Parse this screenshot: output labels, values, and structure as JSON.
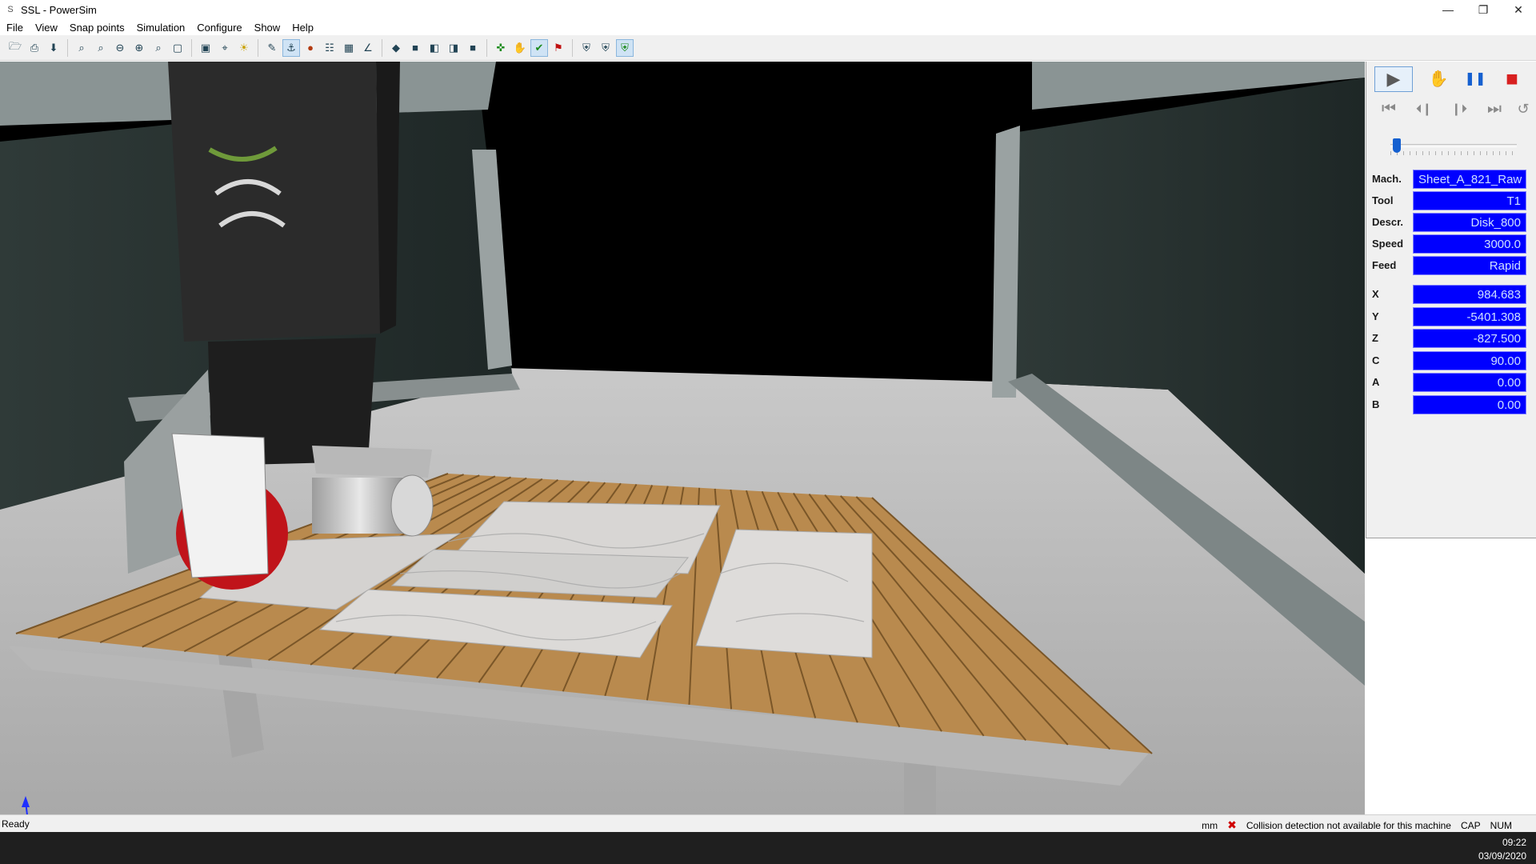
{
  "window": {
    "app_icon_glyph": "S",
    "title": "SSL - PowerSim",
    "minimize_glyph": "—",
    "restore_glyph": "❐",
    "close_glyph": "✕"
  },
  "menu": [
    "File",
    "View",
    "Snap points",
    "Simulation",
    "Configure",
    "Show",
    "Help"
  ],
  "toolbar": {
    "groups": [
      [
        "open-icon",
        "print-icon",
        "import-icon"
      ],
      [
        "zoom-icon",
        "zoom-window-icon",
        "zoom-out-icon",
        "zoom-in-icon",
        "zoom-fit-icon",
        "frame-icon"
      ],
      [
        "camera-icon",
        "select-icon",
        "light-icon"
      ],
      [
        "edit-path-icon",
        "tool-axis-icon",
        "sphere-icon",
        "table-icon",
        "grid-icon",
        "axes-icon"
      ],
      [
        "view-iso-icon",
        "view-front-icon",
        "view-left-icon",
        "view-right-icon",
        "view-top-icon"
      ],
      [
        "move-icon",
        "hand-icon",
        "check-icon",
        "flag-icon"
      ],
      [
        "shield-icon",
        "shield-outline-icon",
        "shield-green-icon"
      ]
    ]
  },
  "sim_controls": {
    "play_glyph": "▶",
    "hand_glyph": "✋",
    "pause_glyph": "❚❚",
    "stop_glyph": "■",
    "first_glyph": "⏮",
    "prev_glyph": "⏴❙",
    "next_glyph": "❙⏵",
    "last_glyph": "⏭",
    "loop_glyph": "↺",
    "slider_position": 0.05
  },
  "info": [
    {
      "label": "Mach.",
      "value": "Sheet_A_821_Raw",
      "align": "left"
    },
    {
      "label": "Tool",
      "value": "T1",
      "align": "right"
    },
    {
      "label": "Descr.",
      "value": "Disk_800",
      "align": "right"
    },
    {
      "label": "Speed",
      "value": "3000.0",
      "align": "right"
    },
    {
      "label": "Feed",
      "value": "Rapid",
      "align": "right"
    }
  ],
  "axes": [
    {
      "label": "X",
      "value": "984.683"
    },
    {
      "label": "Y",
      "value": "-5401.308"
    },
    {
      "label": "Z",
      "value": "-827.500"
    },
    {
      "label": "C",
      "value": "90.00"
    },
    {
      "label": "A",
      "value": "0.00"
    },
    {
      "label": "B",
      "value": "0.00"
    }
  ],
  "status": {
    "ready": "Ready",
    "units": "mm",
    "error_glyph": "✖",
    "collision": "Collision detection not available for this machine",
    "cap": "CAP",
    "num": "NUM"
  },
  "clock": {
    "time": "09:22",
    "date": "03/09/2020"
  },
  "colors": {
    "value_bg": "#0000ff",
    "value_text": "#cfe0ff",
    "wood": "#b98a4e",
    "marble": "#d8d6d4",
    "frame": "#9aa2a2",
    "disk_red": "#c0141a"
  }
}
